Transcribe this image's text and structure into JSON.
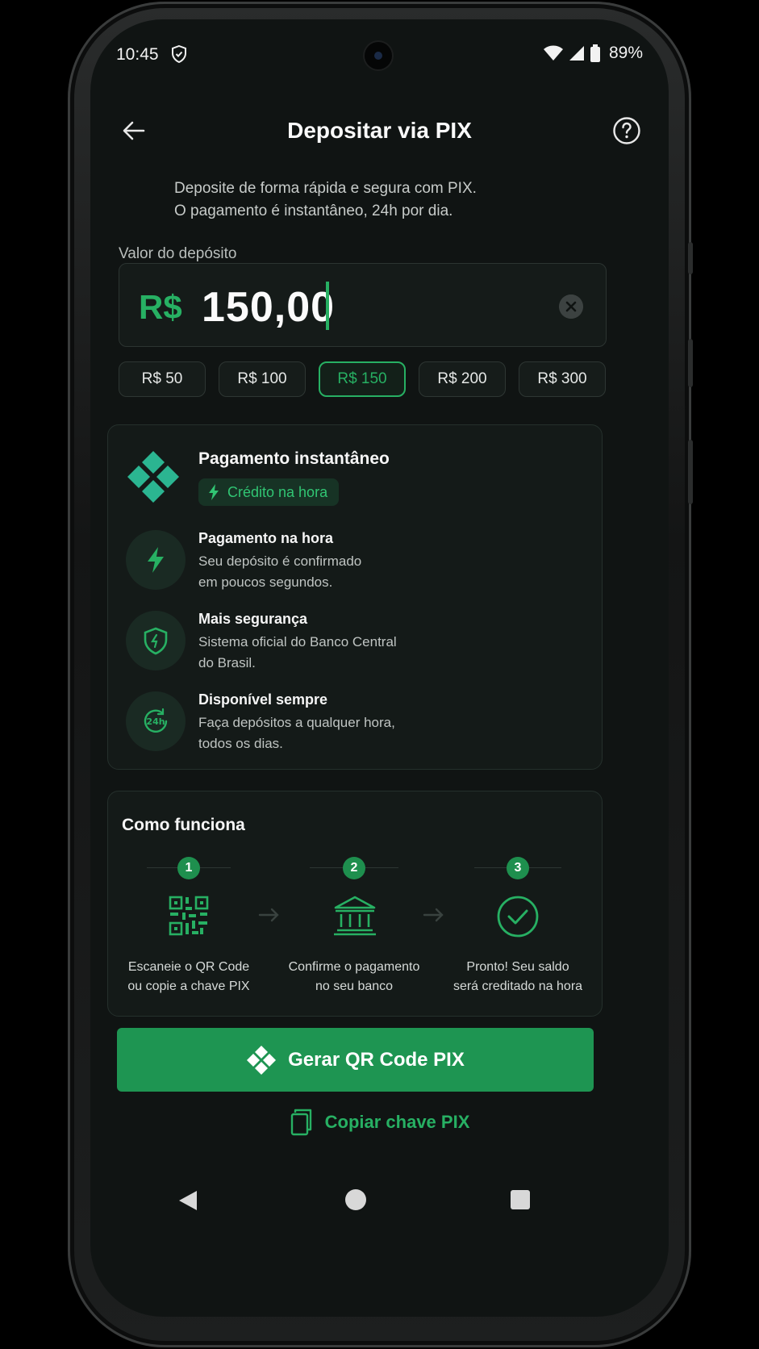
{
  "status_bar": {
    "time": "10:45",
    "battery": "89%"
  },
  "header": {
    "title": "Depositar via PIX"
  },
  "intro": {
    "line1": "Deposite de forma rápida e segura com PIX.",
    "line2": "O pagamento é instantâneo, 24h por dia."
  },
  "amount": {
    "label": "Valor do depósito",
    "currency": "R$",
    "value": "150,00"
  },
  "quick_amounts": [
    {
      "label": "R$ 50",
      "selected": false
    },
    {
      "label": "R$ 100",
      "selected": false
    },
    {
      "label": "R$ 150",
      "selected": true
    },
    {
      "label": "R$ 200",
      "selected": false
    },
    {
      "label": "R$ 300",
      "selected": false
    }
  ],
  "instant_card": {
    "title": "Pagamento instantâneo",
    "tag": "Crédito na hora",
    "features": [
      {
        "icon": "lightning-icon",
        "title": "Pagamento na hora",
        "desc1": "Seu depósito é confirmado",
        "desc2": "em poucos segundos."
      },
      {
        "icon": "shield-icon",
        "title": "Mais segurança",
        "desc1": "Sistema oficial do Banco Central",
        "desc2": "do Brasil."
      },
      {
        "icon": "clock-24h-icon",
        "title": "Disponível sempre",
        "desc1": "Faça depósitos a qualquer hora,",
        "desc2": "todos os dias."
      }
    ]
  },
  "how_it_works": {
    "title": "Como funciona",
    "steps": [
      {
        "num": "1",
        "icon": "qr-code-icon",
        "line1": "Escaneie o QR Code",
        "line2": "ou copie a chave PIX"
      },
      {
        "num": "2",
        "icon": "bank-icon",
        "line1": "Confirme o pagamento",
        "line2": "no seu banco"
      },
      {
        "num": "3",
        "icon": "check-circle-icon",
        "line1": "Pronto! Seu saldo",
        "line2": "será creditado na hora"
      }
    ]
  },
  "actions": {
    "generate": "Gerar QR Code PIX",
    "copy": "Copiar chave PIX"
  },
  "colors": {
    "accent": "#27b063",
    "button": "#1e9552",
    "background": "#101413"
  }
}
